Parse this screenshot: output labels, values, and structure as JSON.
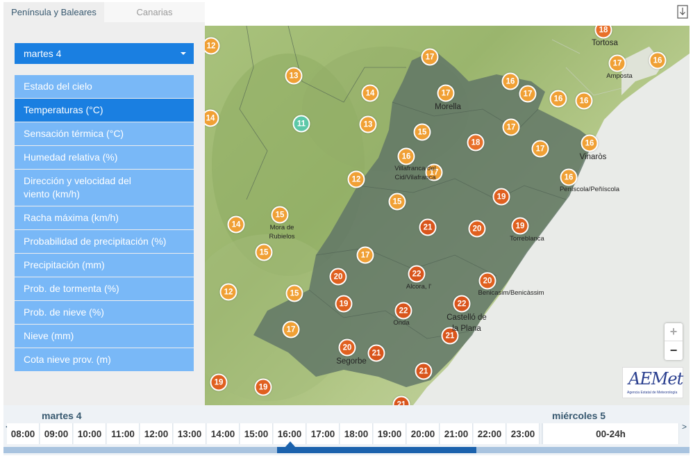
{
  "tabs": {
    "peninsula": "Península y Baleares",
    "canarias": "Canarias"
  },
  "day_select": {
    "value": "martes 4"
  },
  "variables": [
    "Estado del cielo",
    "Temperaturas (°C)",
    "Sensación térmica (°C)",
    "Humedad relativa (%)",
    "Dirección y velocidad del viento (km/h)",
    "Racha máxima (km/h)",
    "Probabilidad de precipitación (%)",
    "Precipitación (mm)",
    "Prob. de tormenta (%)",
    "Prob. de nieve (%)",
    "Nieve (mm)",
    "Cota nieve prov. (m)"
  ],
  "active_variable": "Temperaturas (°C)",
  "map": {
    "colors": {
      "cool": "#5cc8a8",
      "mild": "#f0a035",
      "warm": "#e8702a",
      "hot": "#d9551c"
    },
    "markers": [
      "18",
      "12",
      "17",
      "16",
      "17",
      "13",
      "14",
      "17",
      "16",
      "17",
      "16",
      "16",
      "14",
      "11",
      "13",
      "15",
      "17",
      "18",
      "16",
      "17",
      "16",
      "12",
      "17",
      "16",
      "15",
      "19",
      "14",
      "15",
      "21",
      "20",
      "19",
      "15",
      "17",
      "22",
      "20",
      "12",
      "15",
      "20",
      "19",
      "22",
      "22",
      "17",
      "21",
      "20",
      "21",
      "21",
      "19",
      "19",
      "21"
    ],
    "labels": [
      "Tortosa",
      "Amposta",
      "Morella",
      "Vinaròs",
      "Villafranca del Cid/Vilafranca",
      "Peníscola/Peñíscola",
      "Mora de Rubielos",
      "Torreblanca",
      "Alcora, l'",
      "Benicasim/Benicàssim",
      "Castelló de la Plana",
      "Onda",
      "Segorbe"
    ]
  },
  "zoom": {
    "in": "+",
    "out": "−"
  },
  "logo": {
    "text": "AEMet",
    "subtitle": "Agencia Estatal de Meteorología"
  },
  "timeline": {
    "day1": "martes 4",
    "day2": "miércoles 5",
    "hours": [
      "08:00",
      "09:00",
      "10:00",
      "11:00",
      "12:00",
      "13:00",
      "14:00",
      "15:00",
      "16:00",
      "17:00",
      "18:00",
      "19:00",
      "20:00",
      "21:00",
      "22:00",
      "23:00"
    ],
    "day2_range": "00-24h",
    "selected_hour": "16:00",
    "prev": "<",
    "next": ">"
  }
}
